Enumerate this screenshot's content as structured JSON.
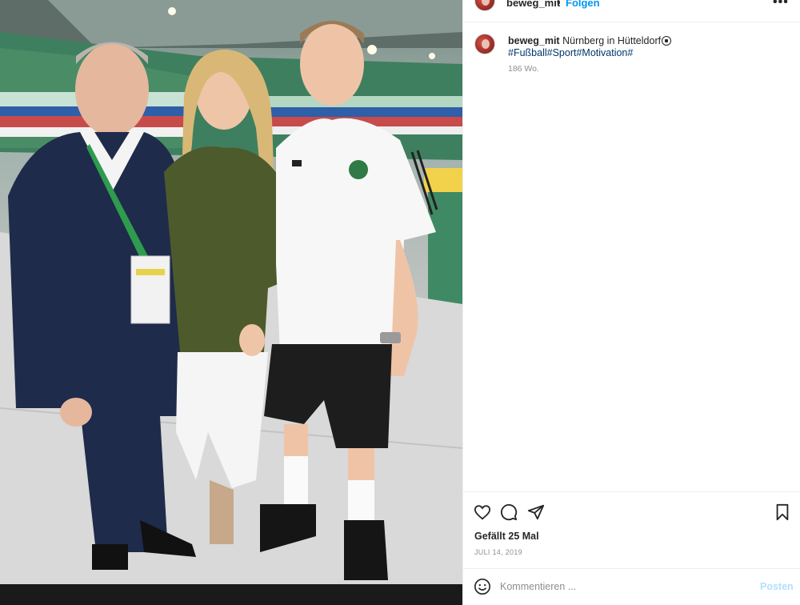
{
  "post": {
    "username": "beweg_mit",
    "separator": "•",
    "follow_label": "Folgen",
    "more_label": "•••",
    "caption": {
      "username": "beweg_mit",
      "text": "Nürnberg in Hütteldorf",
      "hashtags": "#Fußball#Sport#Motivation#",
      "age": "186 Wo."
    },
    "likes": "Gefällt 25 Mal",
    "date": "JULI 14, 2019",
    "comment_placeholder": "Kommentieren ...",
    "post_button": "Posten"
  },
  "icons": {
    "like": "heart-icon",
    "comment": "comment-icon",
    "share": "paper-plane-icon",
    "save": "bookmark-icon",
    "emoji": "smiley-icon"
  },
  "colors": {
    "link_blue": "#0095f6",
    "hashtag": "#00376b",
    "post_disabled": "#b2dffc",
    "muted": "#8e8e8e"
  }
}
